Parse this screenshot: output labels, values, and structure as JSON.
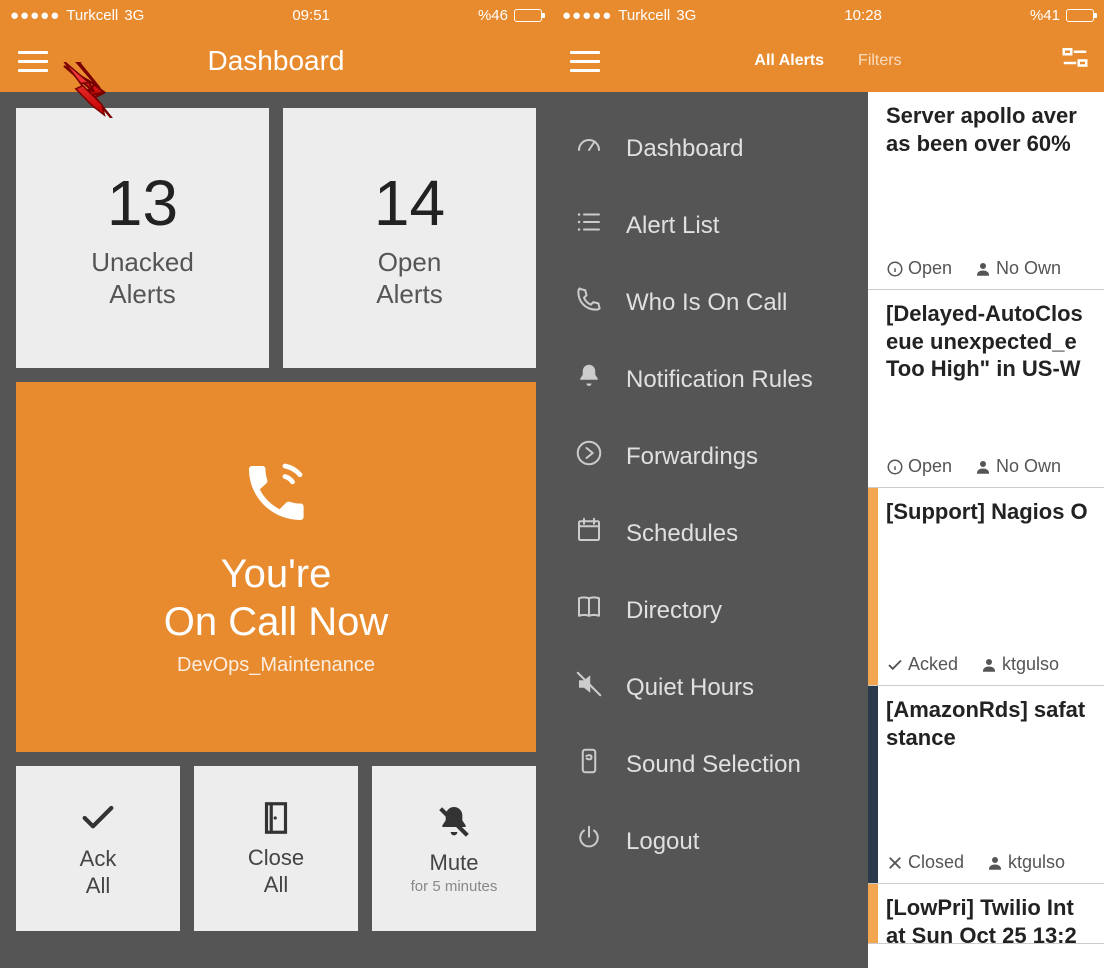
{
  "colors": {
    "orange": "#e88a2e",
    "grey": "#555555",
    "lightTile": "#ededed",
    "stripeOrange": "#f2a650",
    "stripeDark": "#2b3a4a"
  },
  "screen1": {
    "status": {
      "carrier": "Turkcell",
      "network": "3G",
      "time": "09:51",
      "batteryText": "%46",
      "batteryPct": 46
    },
    "nav": {
      "title": "Dashboard"
    },
    "tiles": {
      "unacked": {
        "count": "13",
        "label1": "Unacked",
        "label2": "Alerts"
      },
      "open": {
        "count": "14",
        "label1": "Open",
        "label2": "Alerts"
      }
    },
    "oncall": {
      "line1": "You're",
      "line2": "On Call Now",
      "team": "DevOps_Maintenance"
    },
    "actions": {
      "ack": {
        "label1": "Ack",
        "label2": "All"
      },
      "close": {
        "label1": "Close",
        "label2": "All"
      },
      "mute": {
        "label1": "Mute",
        "sub": "for 5 minutes"
      }
    }
  },
  "screen2": {
    "status": {
      "carrier": "Turkcell",
      "network": "3G",
      "time": "10:28",
      "batteryText": "%41",
      "batteryPct": 41
    },
    "nav": {
      "titleActive": "All Alerts",
      "filters": "Filters"
    },
    "menu": [
      {
        "label": "Dashboard",
        "icon": "gauge"
      },
      {
        "label": "Alert List",
        "icon": "list"
      },
      {
        "label": "Who Is On Call",
        "icon": "phone"
      },
      {
        "label": "Notification Rules",
        "icon": "bell"
      },
      {
        "label": "Forwardings",
        "icon": "forward"
      },
      {
        "label": "Schedules",
        "icon": "calendar"
      },
      {
        "label": "Directory",
        "icon": "book"
      },
      {
        "label": "Quiet Hours",
        "icon": "mute"
      },
      {
        "label": "Sound Selection",
        "icon": "sound"
      },
      {
        "label": "Logout",
        "icon": "power"
      }
    ],
    "alerts": [
      {
        "title": "Server apollo aver\nas been over 60%",
        "statusIcon": "info",
        "status": "Open",
        "ownerIcon": "user",
        "owner": "No Own",
        "stripe": "none"
      },
      {
        "title": "[Delayed-AutoClos\neue unexpected_e\nToo High\" in US-W",
        "statusIcon": "info",
        "status": "Open",
        "ownerIcon": "user",
        "owner": "No Own",
        "stripe": "none"
      },
      {
        "title": "[Support] Nagios O",
        "statusIcon": "check",
        "status": "Acked",
        "ownerIcon": "user",
        "owner": "ktgulso",
        "stripe": "orange"
      },
      {
        "title": "[AmazonRds] safat\nstance",
        "statusIcon": "x",
        "status": "Closed",
        "ownerIcon": "user",
        "owner": "ktgulso",
        "stripe": "dark"
      },
      {
        "title": "[LowPri] Twilio Int\nat Sun Oct 25 13:2",
        "statusIcon": "",
        "status": "",
        "ownerIcon": "",
        "owner": "",
        "stripe": "orange"
      }
    ]
  }
}
